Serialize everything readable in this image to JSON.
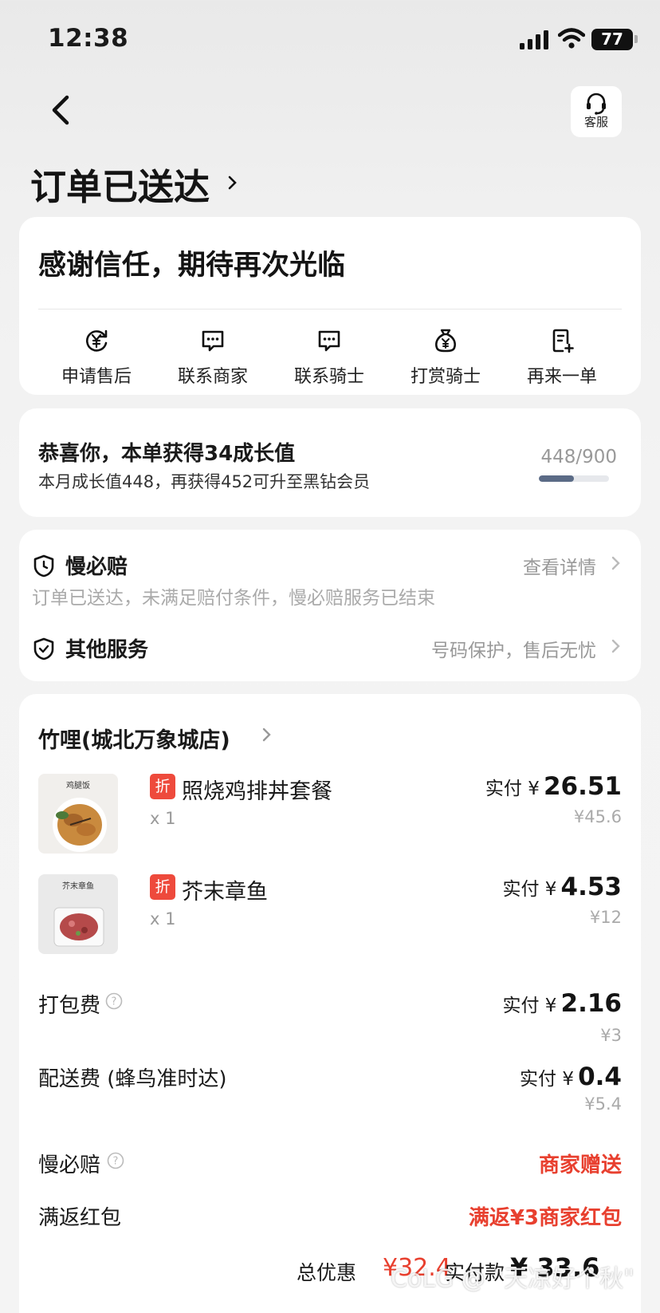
{
  "status_bar": {
    "time": "12:38",
    "battery": "77"
  },
  "header": {
    "service_label": "客服",
    "title": "订单已送达"
  },
  "thanks_card": {
    "message": "感谢信任，期待再次光临",
    "actions": [
      {
        "label": "申请售后",
        "icon": "yen-refresh-icon"
      },
      {
        "label": "联系商家",
        "icon": "chat-bubble-icon"
      },
      {
        "label": "联系骑士",
        "icon": "chat-bubble-icon"
      },
      {
        "label": "打赏骑士",
        "icon": "money-bag-icon"
      },
      {
        "label": "再来一单",
        "icon": "reorder-icon"
      }
    ]
  },
  "growth": {
    "title": "恭喜你，本单获得34成长值",
    "subtitle": "本月成长值448，再获得452可升至黑钻会员",
    "progress_text": "448/900",
    "progress_fraction": 0.498
  },
  "services": {
    "slow_pay": {
      "title": "慢必赔",
      "link": "查看详情",
      "desc": "订单已送达，未满足赔付条件，慢必赔服务已结束"
    },
    "other": {
      "title": "其他服务",
      "right": "号码保护，售后无忧"
    }
  },
  "order": {
    "store_name": "竹哩(城北万象城店)",
    "items": [
      {
        "badge": "折",
        "name": "照烧鸡排丼套餐",
        "qty": "x 1",
        "paid_prefix": "实付 ¥",
        "paid": "26.51",
        "original": "¥45.6",
        "thumb_caption": "鸡腿饭"
      },
      {
        "badge": "折",
        "name": "芥末章鱼",
        "qty": "x 1",
        "paid_prefix": "实付 ¥",
        "paid": "4.53",
        "original": "¥12",
        "thumb_caption": "芥末章鱼"
      }
    ],
    "packing": {
      "label": "打包费",
      "paid_prefix": "实付 ¥",
      "paid": "2.16",
      "original": "¥3"
    },
    "delivery": {
      "label": "配送费 (蜂鸟准时达)",
      "paid_prefix": "实付 ¥",
      "paid": "0.4",
      "original": "¥5.4"
    },
    "slow_pay_row": {
      "label": "慢必赔",
      "value": "商家赠送"
    },
    "redpacket": {
      "label": "满返红包",
      "value": "满返¥3商家红包"
    },
    "total": {
      "discount_label": "总优惠",
      "discount": "¥32.4",
      "paid_label": "实付款",
      "paid": "¥ 33.6"
    }
  },
  "watermark": "CoLG @ \"天凉好个秋\"",
  "colors": {
    "accent_red": "#e8402f",
    "badge_red": "#ee4a3c",
    "progress": "#5b6b86"
  }
}
